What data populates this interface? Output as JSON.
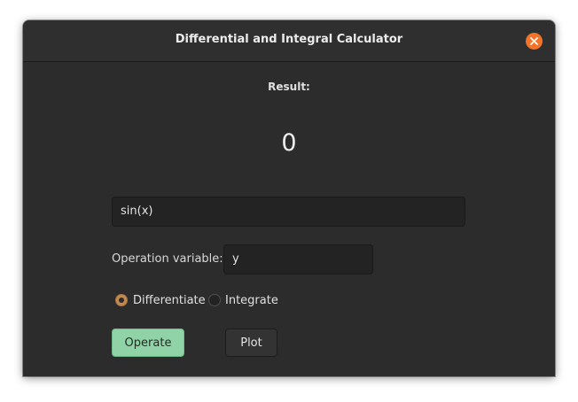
{
  "window": {
    "title": "Differential and Integral Calculator"
  },
  "result": {
    "label": "Result:",
    "value": "0"
  },
  "expression_input": {
    "value": "sin(x)"
  },
  "operation_variable": {
    "label": "Operation variable:",
    "value": "y"
  },
  "mode": {
    "options": [
      "Differentiate",
      "Integrate"
    ],
    "selected": "Differentiate"
  },
  "actions": {
    "operate_label": "Operate",
    "plot_label": "Plot"
  },
  "colors": {
    "accent_close": "#f37329",
    "accent_radio": "#c08a52",
    "operate_button": "#8fd3a7",
    "window_bg": "#2c2c2c"
  }
}
